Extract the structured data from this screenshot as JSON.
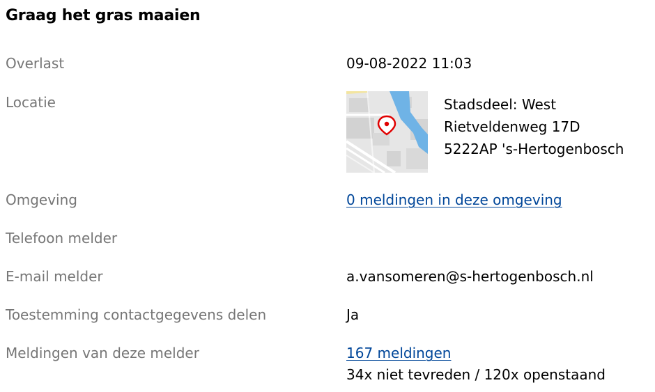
{
  "title": "Graag het gras maaien",
  "rows": {
    "overlast": {
      "label": "Overlast",
      "value": "09-08-2022 11:03"
    },
    "locatie": {
      "label": "Locatie",
      "map_icon": "map-pin-icon",
      "address": {
        "district": "Stadsdeel: West",
        "street": "Rietveldenweg 17D",
        "postcode_city": "5222AP 's-Hertogenbosch"
      }
    },
    "omgeving": {
      "label": "Omgeving",
      "link": "0 meldingen in deze omgeving"
    },
    "telefoon": {
      "label": "Telefoon melder",
      "value": ""
    },
    "email": {
      "label": "E-mail melder",
      "value": "a.vansomeren@s-hertogenbosch.nl"
    },
    "toestemming": {
      "label": "Toestemming contactgegevens delen",
      "value": "Ja"
    },
    "meldingen": {
      "label": "Meldingen van deze melder",
      "link": "167 meldingen",
      "summary": "34x niet tevreden / 120x openstaand"
    }
  },
  "colors": {
    "label": "#767676",
    "link": "#004699",
    "water": "#6fb3e6",
    "pin": "#e00000"
  }
}
